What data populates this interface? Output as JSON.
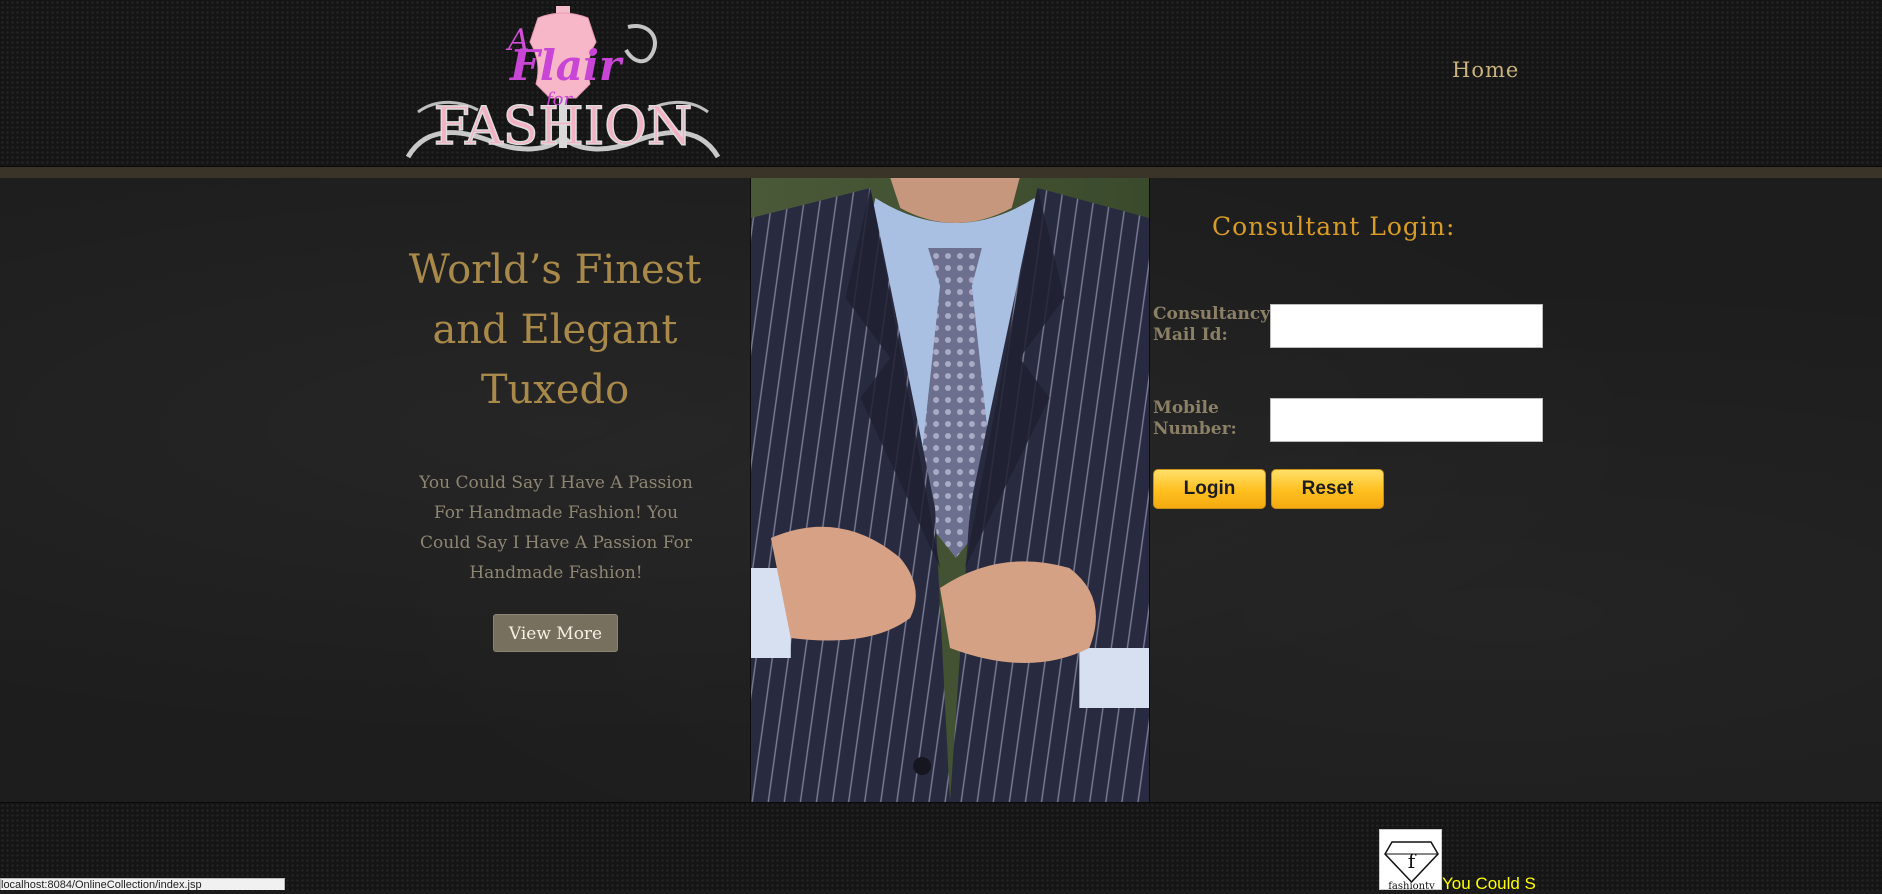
{
  "header": {
    "logo": {
      "line1": "A",
      "line2": "Flair",
      "line3": "for",
      "line4": "FASHION"
    },
    "nav": {
      "home": "Home"
    }
  },
  "hero": {
    "title_lines": [
      "World’s Finest",
      "and Elegant",
      "Tuxedo"
    ],
    "text": "You Could Say I Have A Passion For Handmade Fashion! You Could Say I Have A Passion For Handmade Fashion!",
    "button": "View More"
  },
  "login": {
    "title": "Consultant Login:",
    "email_label": "Consultancy Mail Id:",
    "email_value": "",
    "mobile_label": "Mobile Number:",
    "mobile_value": "",
    "login_button": "Login",
    "reset_button": "Reset"
  },
  "footer": {
    "status_url": "localhost:8084/OnlineCollection/index.jsp",
    "badge_text": "fashiontv",
    "badge_letter": "f",
    "marquee": "You Could S"
  },
  "colors": {
    "accent_gold": "#a8894a",
    "login_title": "#d79b27",
    "button_yellow": "#ffbf1f",
    "marquee_yellow": "#ffff00"
  },
  "icons": {
    "logo": "dress-form-logo",
    "badge": "diamond-f-icon"
  }
}
